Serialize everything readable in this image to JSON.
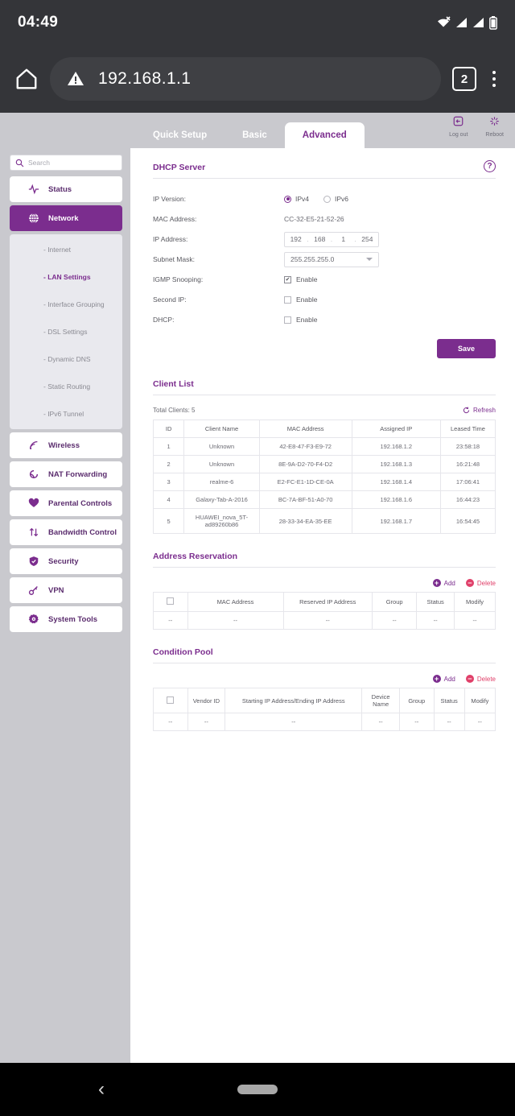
{
  "status_bar": {
    "time": "04:49",
    "icons": [
      "wifi-off-icon",
      "signal-icon",
      "signal-icon",
      "battery-icon"
    ]
  },
  "browser": {
    "home_icon": "home-icon",
    "security_icon": "warning-triangle-icon",
    "url": "192.168.1.1",
    "tab_count": "2",
    "menu_icon": "overflow-menu-icon"
  },
  "router": {
    "tabs": [
      {
        "label": "Quick Setup",
        "active": false
      },
      {
        "label": "Basic",
        "active": false
      },
      {
        "label": "Advanced",
        "active": true
      }
    ],
    "actions": [
      {
        "label": "Log out",
        "icon": "logout-icon"
      },
      {
        "label": "Reboot",
        "icon": "reboot-icon"
      }
    ],
    "search": {
      "placeholder": "Search",
      "icon": "search-icon"
    },
    "nav": [
      {
        "label": "Status",
        "icon": "pulse-icon",
        "active": false
      },
      {
        "label": "Network",
        "icon": "globe-icon",
        "active": true
      },
      {
        "label": "Wireless",
        "icon": "wireless-icon",
        "active": false
      },
      {
        "label": "NAT Forwarding",
        "icon": "nat-icon",
        "active": false
      },
      {
        "label": "Parental Controls",
        "icon": "heart-icon",
        "active": false
      },
      {
        "label": "Bandwidth Control",
        "icon": "updown-arrows-icon",
        "active": false
      },
      {
        "label": "Security",
        "icon": "shield-icon",
        "active": false
      },
      {
        "label": "VPN",
        "icon": "key-icon",
        "active": false
      },
      {
        "label": "System Tools",
        "icon": "gear-icon",
        "active": false
      }
    ],
    "submenu": [
      {
        "label": "- Internet",
        "active": false
      },
      {
        "label": "- LAN Settings",
        "active": true
      },
      {
        "label": "- Interface Grouping",
        "active": false
      },
      {
        "label": "- DSL Settings",
        "active": false
      },
      {
        "label": "- Dynamic DNS",
        "active": false
      },
      {
        "label": "- Static Routing",
        "active": false
      },
      {
        "label": "- IPv6 Tunnel",
        "active": false
      }
    ]
  },
  "dhcp_server": {
    "title": "DHCP Server",
    "help_glyph": "?",
    "ip_version": {
      "label": "IP Version:",
      "options": [
        "IPv4",
        "IPv6"
      ],
      "selected": "IPv4"
    },
    "mac_address": {
      "label": "MAC Address:",
      "value": "CC-32-E5-21-52-26"
    },
    "ip_address": {
      "label": "IP Address:",
      "octets": [
        "192",
        "168",
        "1",
        "254"
      ]
    },
    "subnet_mask": {
      "label": "Subnet Mask:",
      "value": "255.255.255.0"
    },
    "igmp_snooping": {
      "label": "IGMP Snooping:",
      "checkbox_label": "Enable",
      "checked": true
    },
    "second_ip": {
      "label": "Second IP:",
      "checkbox_label": "Enable",
      "checked": false
    },
    "dhcp": {
      "label": "DHCP:",
      "checkbox_label": "Enable",
      "checked": false
    },
    "save_label": "Save"
  },
  "client_list": {
    "title": "Client List",
    "total_label": "Total Clients: 5",
    "refresh_label": "Refresh",
    "columns": [
      "ID",
      "Client Name",
      "MAC Address",
      "Assigned IP",
      "Leased Time"
    ],
    "rows": [
      [
        "1",
        "Unknown",
        "42-E8-47-F3-E9-72",
        "192.168.1.2",
        "23:58:18"
      ],
      [
        "2",
        "Unknown",
        "8E-9A-D2-70-F4-D2",
        "192.168.1.3",
        "16:21:48"
      ],
      [
        "3",
        "realme-6",
        "E2-FC-E1-1D-CE-0A",
        "192.168.1.4",
        "17:06:41"
      ],
      [
        "4",
        "Galaxy-Tab-A-2016",
        "BC-7A-BF-51-A0-70",
        "192.168.1.6",
        "16:44:23"
      ],
      [
        "5",
        "HUAWEI_nova_5T-ad89260b86",
        "28-33-34-EA-35-EE",
        "192.168.1.7",
        "16:54:45"
      ]
    ]
  },
  "address_reservation": {
    "title": "Address Reservation",
    "add_label": "Add",
    "delete_label": "Delete",
    "columns": [
      "",
      "MAC Address",
      "Reserved IP Address",
      "Group",
      "Status",
      "Modify"
    ],
    "rows": [
      [
        "--",
        "--",
        "--",
        "--",
        "--",
        "--"
      ]
    ]
  },
  "condition_pool": {
    "title": "Condition Pool",
    "add_label": "Add",
    "delete_label": "Delete",
    "columns": [
      "",
      "Vendor ID",
      "Starting IP Address/Ending IP Address",
      "Device Name",
      "Group",
      "Status",
      "Modify"
    ],
    "rows": [
      [
        "--",
        "--",
        "--",
        "--",
        "--",
        "--",
        "--"
      ]
    ]
  },
  "nav_bar": {
    "back_glyph": "‹",
    "home_icon": "home-pill-icon"
  }
}
